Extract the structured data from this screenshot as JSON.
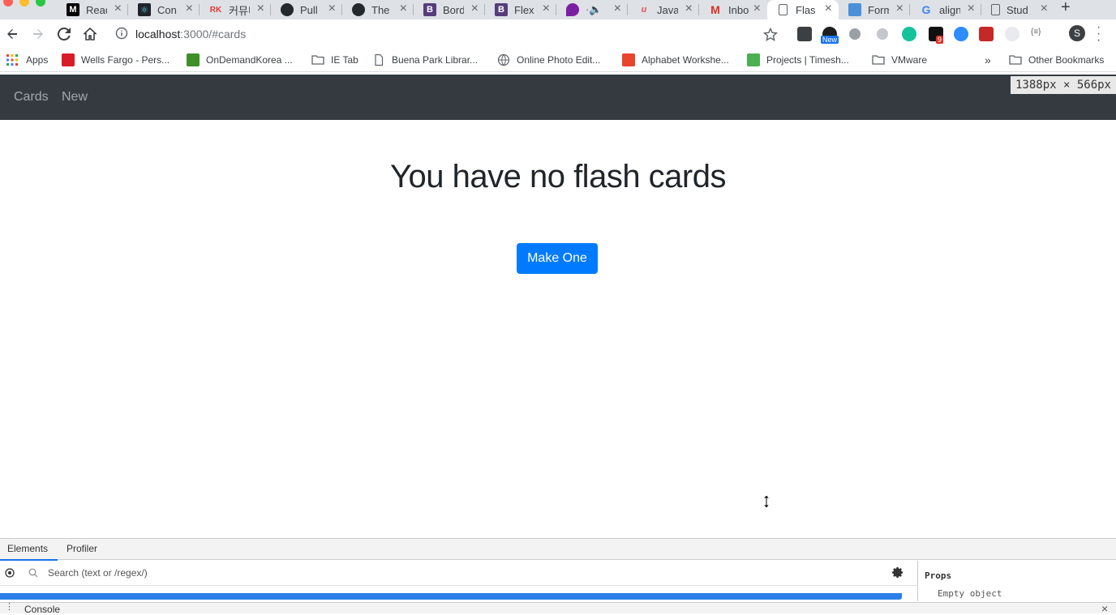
{
  "browser": {
    "tabs": [
      {
        "title": "Read",
        "icon": "medium-icon",
        "color": "#000000"
      },
      {
        "title": "Con",
        "icon": "react-icon",
        "color": "#20232a"
      },
      {
        "title": "커뮤니",
        "icon": "rk-icon",
        "color": "#e53935"
      },
      {
        "title": "Pull",
        "icon": "github-icon",
        "color": "#24292e"
      },
      {
        "title": "The",
        "icon": "github-icon",
        "color": "#24292e"
      },
      {
        "title": "Bord",
        "icon": "bootstrap-icon",
        "color": "#563d7c"
      },
      {
        "title": "Flex",
        "icon": "bootstrap-icon",
        "color": "#563d7c"
      },
      {
        "title": "",
        "icon": "audio-icon",
        "color": "#7b1fa2"
      },
      {
        "title": "Java",
        "icon": "udemy-icon",
        "color": "#ec5252"
      },
      {
        "title": "Inbo",
        "icon": "gmail-icon",
        "color": "#d93025"
      },
      {
        "title": "Flas",
        "icon": "page-icon",
        "color": "#5f6368"
      },
      {
        "title": "Form",
        "icon": "form-icon",
        "color": "#4a90d9"
      },
      {
        "title": "align",
        "icon": "google-icon",
        "color": "#4285f4"
      },
      {
        "title": "Stud",
        "icon": "page-icon",
        "color": "#5f6368"
      }
    ],
    "tab_close": "×",
    "new_tab": "+",
    "url_host": "localhost",
    "url_path": ":3000/#cards",
    "profile_initial": "S",
    "new_badge": "New",
    "ext_badge": "9",
    "bookmarks": [
      {
        "label": "Apps",
        "icon": "apps-grid-icon"
      },
      {
        "label": "Wells Fargo - Pers...",
        "icon": "wellsfargo-icon"
      },
      {
        "label": "OnDemandKorea ...",
        "icon": "play-icon"
      },
      {
        "label": "IE Tab",
        "icon": "folder-icon"
      },
      {
        "label": "Buena Park Librar...",
        "icon": "page-icon"
      },
      {
        "label": "Online Photo Edit...",
        "icon": "globe-icon"
      },
      {
        "label": "Alphabet Workshe...",
        "icon": "worksheet-icon"
      },
      {
        "label": "Projects | Timesh...",
        "icon": "timesheet-icon"
      },
      {
        "label": "VMware",
        "icon": "folder-icon"
      }
    ],
    "bookmarks_more": "»",
    "other_bookmarks": "Other Bookmarks"
  },
  "app": {
    "nav": [
      {
        "label": "Cards"
      },
      {
        "label": "New"
      }
    ],
    "viewport_size": "1388px × 566px",
    "headline": "You have no flash cards",
    "cta": "Make One"
  },
  "devtools": {
    "tabs": [
      "Elements",
      "Profiler"
    ],
    "search_placeholder": "Search (text or /regex/)",
    "props_header": "Props",
    "props_value": "Empty object",
    "drawer_label": "Console",
    "drawer_close": "×"
  },
  "colors": {
    "navbar": "#343a40",
    "primary": "#007bff",
    "selection": "#2b7de9"
  }
}
